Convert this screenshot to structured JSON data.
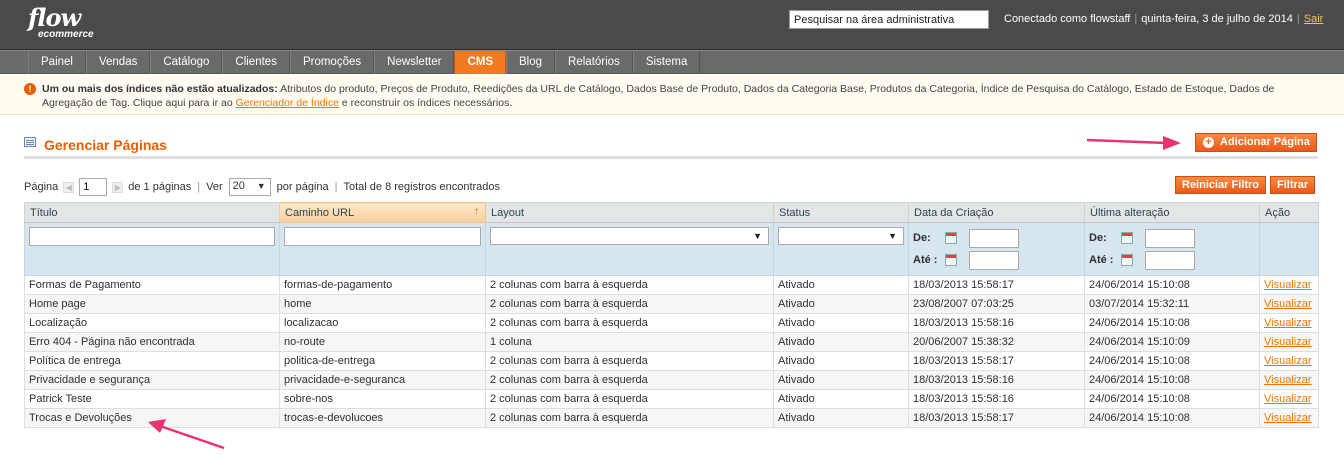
{
  "header": {
    "logo_line1": "flow",
    "logo_line2": "ecommerce",
    "search_placeholder": "Pesquisar na área administrativa",
    "connected_as": "Conectado como flowstaff",
    "date": "quinta-feira, 3 de julho de 2014",
    "logout": "Sair"
  },
  "nav": {
    "items": [
      {
        "label": "Painel"
      },
      {
        "label": "Vendas"
      },
      {
        "label": "Catálogo"
      },
      {
        "label": "Clientes"
      },
      {
        "label": "Promoções"
      },
      {
        "label": "Newsletter"
      },
      {
        "label": "CMS"
      },
      {
        "label": "Blog"
      },
      {
        "label": "Relatórios"
      },
      {
        "label": "Sistema"
      }
    ],
    "active": "CMS"
  },
  "notice": {
    "bold": "Um ou mais dos índices não estão atualizados:",
    "text": " Atributos do produto, Preços de Produto, Reedições da URL de Catálogo, Dados Base de Produto, Dados da Categoria Base, Produtos da Categoria, Índice de Pesquisa do Catálogo, Estado de Estoque, Dados de Agregação de Tag. Clique aqui para ir ao ",
    "link": "Gerenciador de Índice",
    "text_after": " e reconstruir os índices necessários."
  },
  "page": {
    "title": "Gerenciar Páginas",
    "add_button": "Adicionar Página"
  },
  "pager": {
    "page_label": "Página",
    "page_value": "1",
    "of_pages": "de 1 páginas",
    "view_label": "Ver",
    "per_page_value": "20",
    "per_page_label": "por página",
    "total": "Total de 8 registros encontrados",
    "reset_filter": "Reiniciar Filtro",
    "filter": "Filtrar"
  },
  "grid": {
    "columns": {
      "title": "Título",
      "url": "Caminho URL",
      "layout": "Layout",
      "status": "Status",
      "created": "Data da Criação",
      "modified": "Última alteração",
      "action": "Ação"
    },
    "filter": {
      "from_label": "De:",
      "to_label": "Até :"
    },
    "rows": [
      {
        "title": "Formas de Pagamento",
        "url": "formas-de-pagamento",
        "layout": "2 colunas com barra à esquerda",
        "status": "Ativado",
        "created": "18/03/2013 15:58:17",
        "modified": "24/06/2014 15:10:08",
        "action": "Visualizar"
      },
      {
        "title": "Home page",
        "url": "home",
        "layout": "2 colunas com barra à esquerda",
        "status": "Ativado",
        "created": "23/08/2007 07:03:25",
        "modified": "03/07/2014 15:32:11",
        "action": "Visualizar"
      },
      {
        "title": "Localização",
        "url": "localizacao",
        "layout": "2 colunas com barra à esquerda",
        "status": "Ativado",
        "created": "18/03/2013 15:58:16",
        "modified": "24/06/2014 15:10:08",
        "action": "Visualizar"
      },
      {
        "title": "Erro 404 - Página não encontrada",
        "url": "no-route",
        "layout": "1 coluna",
        "status": "Ativado",
        "created": "20/06/2007 15:38:32",
        "modified": "24/06/2014 15:10:09",
        "action": "Visualizar"
      },
      {
        "title": "Política de entrega",
        "url": "politica-de-entrega",
        "layout": "2 colunas com barra à esquerda",
        "status": "Ativado",
        "created": "18/03/2013 15:58:17",
        "modified": "24/06/2014 15:10:08",
        "action": "Visualizar"
      },
      {
        "title": "Privacidade e segurança",
        "url": "privacidade-e-seguranca",
        "layout": "2 colunas com barra à esquerda",
        "status": "Ativado",
        "created": "18/03/2013 15:58:16",
        "modified": "24/06/2014 15:10:08",
        "action": "Visualizar"
      },
      {
        "title": "Patrick Teste",
        "url": "sobre-nos",
        "layout": "2 colunas com barra à esquerda",
        "status": "Ativado",
        "created": "18/03/2013 15:58:16",
        "modified": "24/06/2014 15:10:08",
        "action": "Visualizar"
      },
      {
        "title": "Trocas e Devoluções",
        "url": "trocas-e-devolucoes",
        "layout": "2 colunas com barra à esquerda",
        "status": "Ativado",
        "created": "18/03/2013 15:58:17",
        "modified": "24/06/2014 15:10:08",
        "action": "Visualizar"
      }
    ]
  },
  "colors": {
    "accent": "#f37a1f",
    "annotation_arrow": "#e8336d"
  }
}
